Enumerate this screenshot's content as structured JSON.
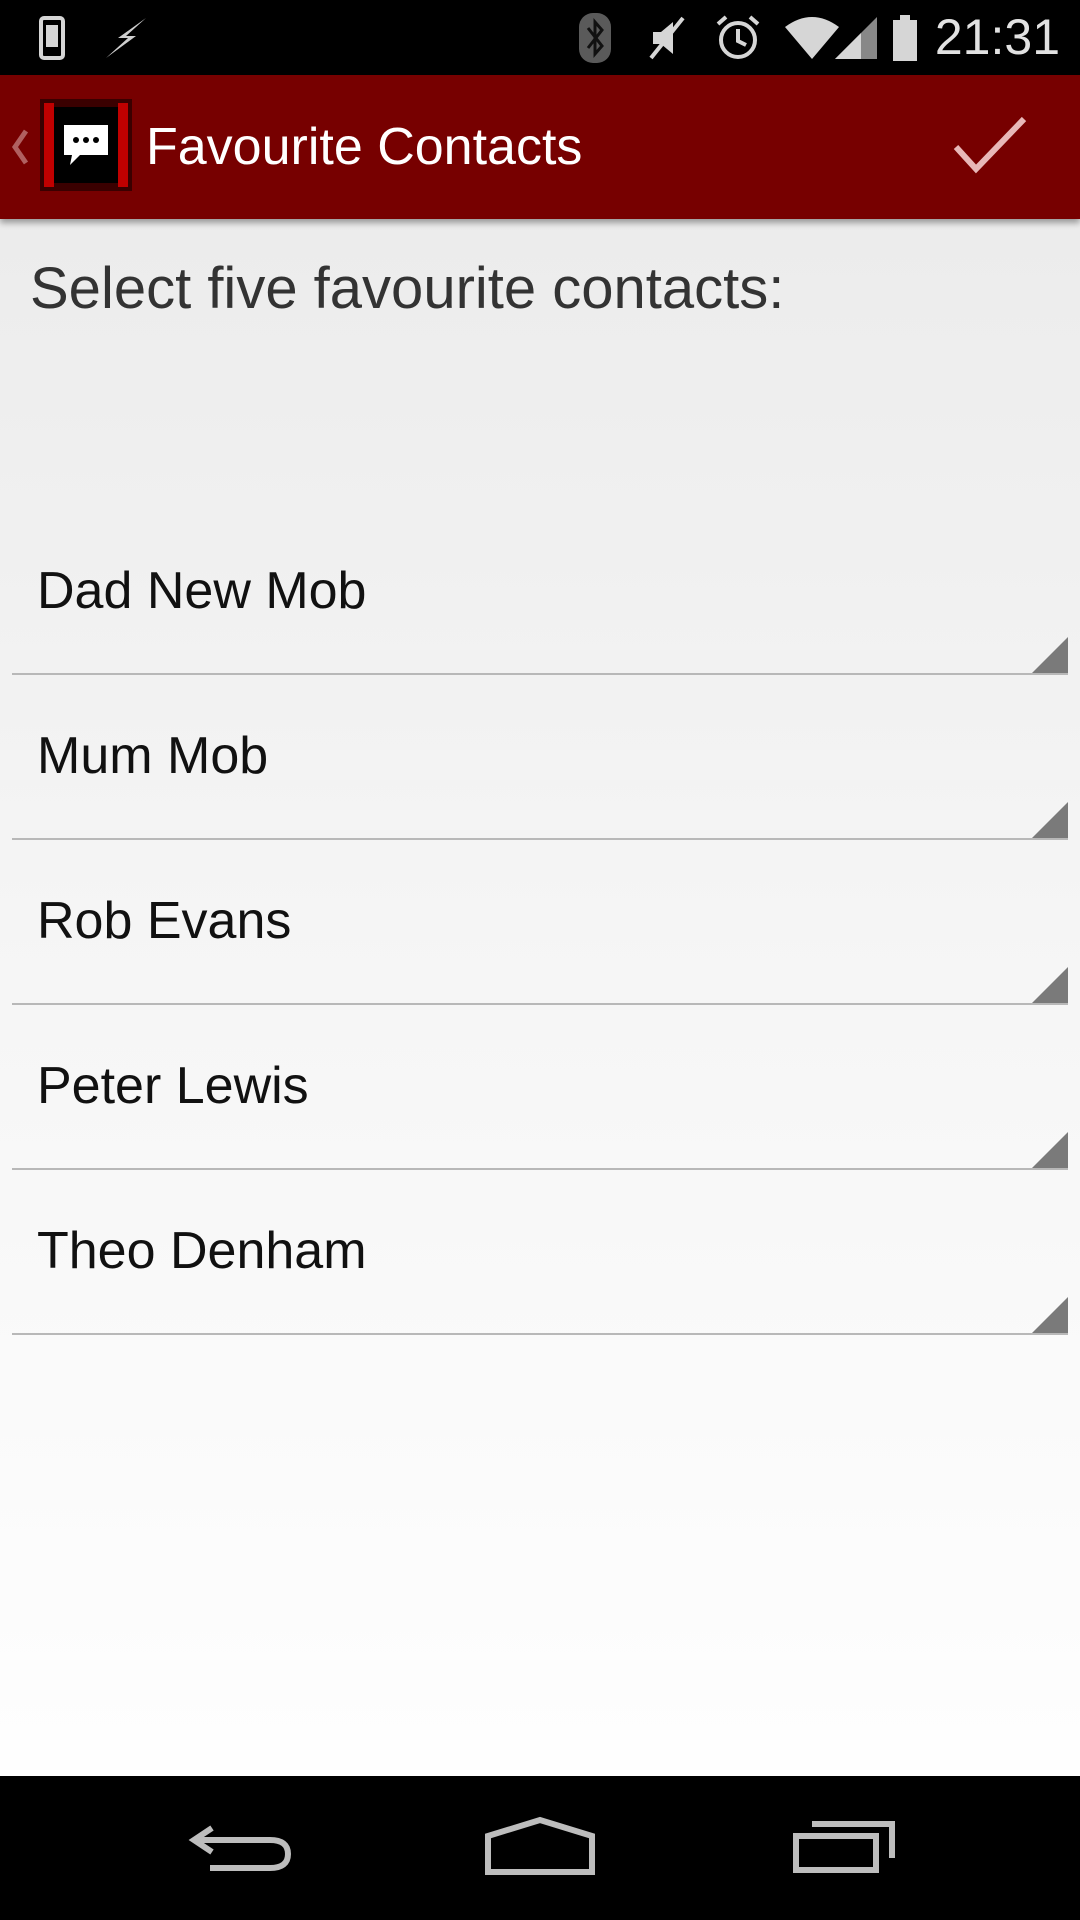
{
  "status_bar": {
    "time": "21:31",
    "icons": [
      "phone-icon",
      "charging-icon",
      "bluetooth-icon",
      "vibrate-mute-icon",
      "alarm-icon",
      "wifi-icon",
      "signal-icon",
      "battery-icon"
    ]
  },
  "action_bar": {
    "title": "Favourite Contacts",
    "up_icon": "chevron-left-icon",
    "app_icon": "chat-bubble-icon",
    "done_icon": "checkmark-icon",
    "background_color": "#770000"
  },
  "content": {
    "prompt": "Select five favourite contacts:",
    "contacts": [
      {
        "label": "Dad New Mob"
      },
      {
        "label": "Mum Mob"
      },
      {
        "label": "Rob Evans"
      },
      {
        "label": "Peter Lewis"
      },
      {
        "label": "Theo Denham"
      }
    ]
  },
  "nav_bar": {
    "back_icon": "back-arrow-icon",
    "home_icon": "home-icon",
    "recents_icon": "recent-apps-icon"
  }
}
